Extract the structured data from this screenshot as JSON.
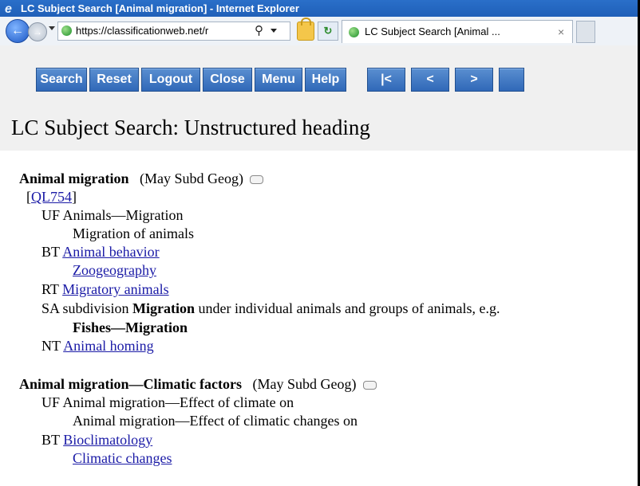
{
  "window": {
    "title": "LC Subject Search [Animal migration] - Internet Explorer"
  },
  "browser": {
    "url": "https://classificationweb.net/r",
    "tab_title": "LC Subject Search [Animal ...",
    "tab_close": "×"
  },
  "toolbar": {
    "buttons": [
      "Search",
      "Reset",
      "Logout",
      "Close",
      "Menu",
      "Help",
      "|<",
      "<",
      ">"
    ]
  },
  "page": {
    "title": "LC Subject Search: Unstructured heading"
  },
  "entries": [
    {
      "heading": "Animal migration",
      "qualifier": "(May Subd Geog)",
      "call_number": "QL754",
      "uf": [
        "Animals—Migration",
        "Migration of animals"
      ],
      "bt": [
        "Animal behavior",
        "Zoogeography"
      ],
      "rt": [
        "Migratory animals"
      ],
      "sa_prefix": "subdivision",
      "sa_bold": "Migration",
      "sa_suffix": "under individual animals and groups of animals, e.g.",
      "sa_example": "Fishes—Migration",
      "nt": [
        "Animal homing"
      ]
    },
    {
      "heading": "Animal migration—Climatic factors",
      "qualifier": "(May Subd Geog)",
      "uf": [
        "Animal migration—Effect of climate on",
        "Animal migration—Effect of climatic changes on"
      ],
      "bt": [
        "Bioclimatology",
        "Climatic changes"
      ]
    }
  ],
  "labels": {
    "uf": "UF",
    "bt": "BT",
    "rt": "RT",
    "sa": "SA",
    "nt": "NT"
  }
}
